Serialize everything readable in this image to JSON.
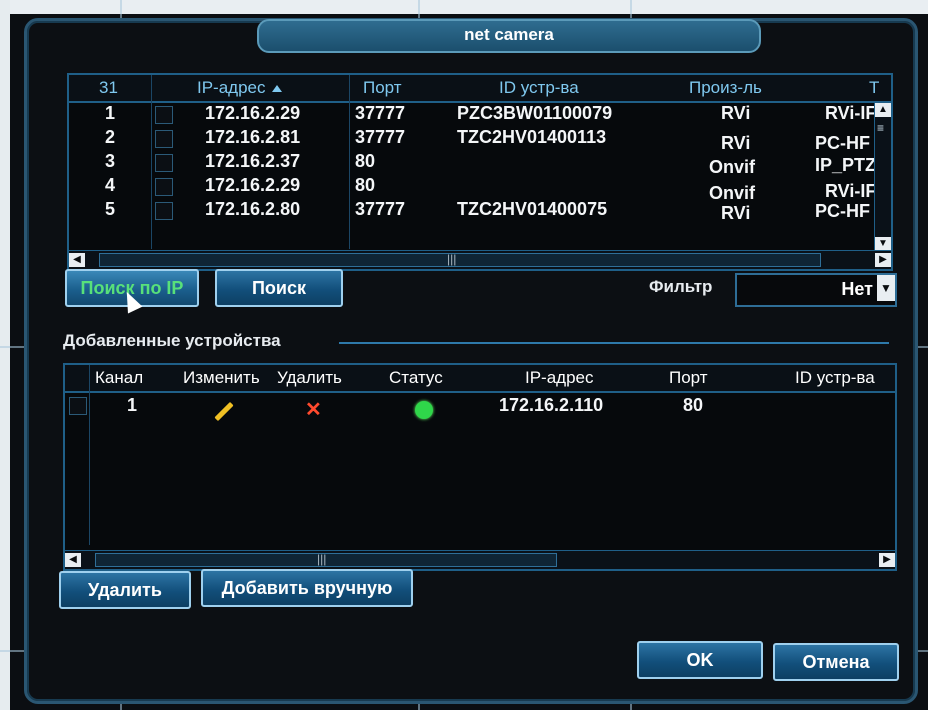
{
  "window": {
    "title": "net camera"
  },
  "found_table": {
    "headers": {
      "count": "31",
      "ip": "IP-адрес",
      "port": "Порт",
      "id": "ID устр-ва",
      "maker": "Произ-ль",
      "type": "Т"
    },
    "rows": [
      {
        "n": "1",
        "ip": "172.16.2.29",
        "port": "37777",
        "id": "PZC3BW01100079",
        "maker": "RVi",
        "type": "RVi-IF"
      },
      {
        "n": "2",
        "ip": "172.16.2.81",
        "port": "37777",
        "id": "TZC2HV01400113",
        "maker": "RVi",
        "type": "PC-HF"
      },
      {
        "n": "3",
        "ip": "172.16.2.37",
        "port": "80",
        "id": "",
        "maker": "Onvif",
        "type": "IP_PTZ"
      },
      {
        "n": "4",
        "ip": "172.16.2.29",
        "port": "80",
        "id": "",
        "maker": "Onvif",
        "type": "RVi-IF"
      },
      {
        "n": "5",
        "ip": "172.16.2.80",
        "port": "37777",
        "id": "TZC2HV01400075",
        "maker": "RVi",
        "type": "PC-HF"
      }
    ]
  },
  "toolbar": {
    "search_ip": "Поиск по IP",
    "search": "Поиск",
    "filter_label": "Фильтр",
    "filter_value": "Нет"
  },
  "added": {
    "section_title": "Добавленные устройства",
    "headers": {
      "channel": "Канал",
      "edit": "Изменить",
      "delete": "Удалить",
      "status": "Статус",
      "ip": "IP-адрес",
      "port": "Порт",
      "id": "ID устр-ва"
    },
    "rows": [
      {
        "channel": "1",
        "ip": "172.16.2.110",
        "port": "80",
        "status": "online"
      }
    ]
  },
  "bottom": {
    "delete": "Удалить",
    "add_manual": "Добавить вручную",
    "ok": "OK",
    "cancel": "Отмена"
  },
  "colors": {
    "accent": "#2d74a4",
    "header_text": "#7fc8ef",
    "status_online": "#2fd64a",
    "delete_icon": "#ff4a2e",
    "edit_icon": "#f0c024"
  }
}
